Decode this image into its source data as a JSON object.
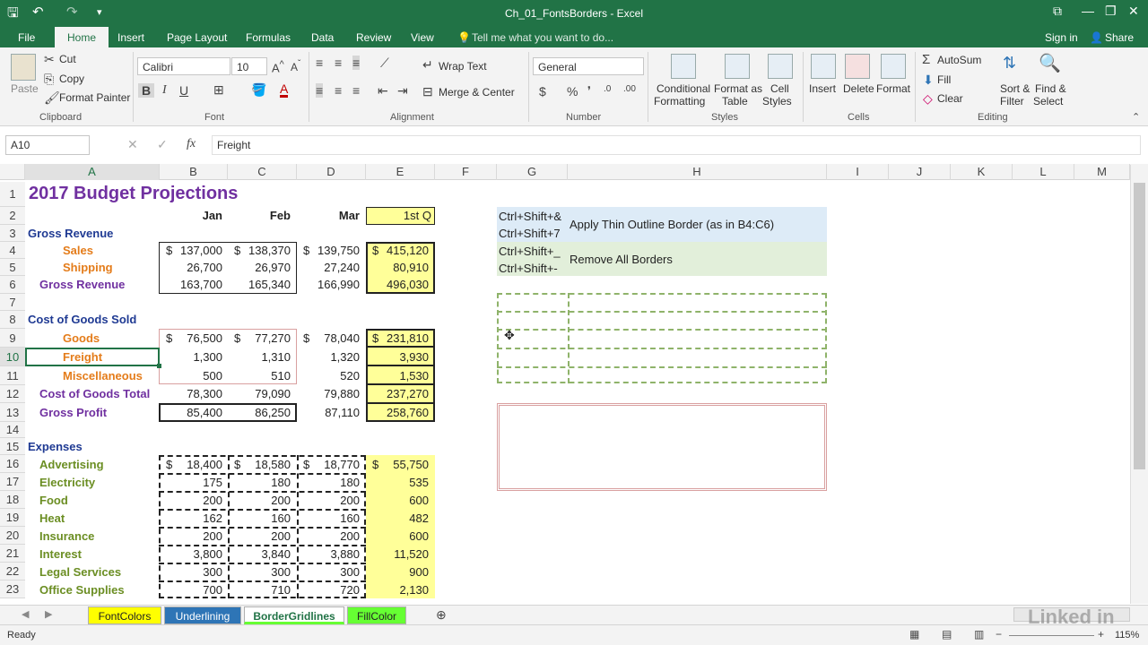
{
  "window": {
    "title": "Ch_01_FontsBorders - Excel"
  },
  "tabs": [
    "File",
    "Home",
    "Insert",
    "Page Layout",
    "Formulas",
    "Data",
    "Review",
    "View"
  ],
  "tell_me": "Tell me what you want to do...",
  "account": {
    "sign_in": "Sign in",
    "share": "Share"
  },
  "ribbon": {
    "clipboard": {
      "paste": "Paste",
      "cut": "Cut",
      "copy": "Copy",
      "format_painter": "Format Painter",
      "label": "Clipboard"
    },
    "font": {
      "name": "Calibri",
      "size": "10",
      "label": "Font"
    },
    "alignment": {
      "wrap": "Wrap Text",
      "merge": "Merge & Center",
      "label": "Alignment"
    },
    "number": {
      "format": "General",
      "label": "Number"
    },
    "styles": {
      "cond1": "Conditional",
      "cond2": "Formatting",
      "fmt1": "Format as",
      "fmt2": "Table",
      "cell1": "Cell",
      "cell2": "Styles",
      "label": "Styles"
    },
    "cells": {
      "insert": "Insert",
      "delete": "Delete",
      "format": "Format",
      "label": "Cells"
    },
    "editing": {
      "autosum": "AutoSum",
      "fill": "Fill",
      "clear": "Clear",
      "sort1": "Sort &",
      "sort2": "Filter",
      "find1": "Find &",
      "find2": "Select",
      "label": "Editing"
    }
  },
  "formula_bar": {
    "name_box": "A10",
    "value": "Freight"
  },
  "columns": [
    "A",
    "B",
    "C",
    "D",
    "E",
    "F",
    "G",
    "H",
    "I",
    "J",
    "K",
    "L",
    "M"
  ],
  "rows": [
    "1",
    "2",
    "3",
    "4",
    "5",
    "6",
    "7",
    "8",
    "9",
    "10",
    "11",
    "12",
    "13",
    "14",
    "15",
    "16",
    "17",
    "18",
    "19",
    "20",
    "21",
    "22",
    "23"
  ],
  "sheet": {
    "title": "2017 Budget Projections",
    "h_jan": "Jan",
    "h_feb": "Feb",
    "h_mar": "Mar",
    "h_q": "1st Q",
    "gross_revenue": "Gross Revenue",
    "sales": "Sales",
    "shipping": "Shipping",
    "gross_revenue_total": "Gross Revenue",
    "cogs": "Cost of Goods Sold",
    "goods": "Goods",
    "freight": "Freight",
    "misc": "Miscellaneous",
    "cogs_total": "Cost of Goods Total",
    "gross_profit": "Gross Profit",
    "expenses": "Expenses",
    "sales_vals": [
      "137,000",
      "138,370",
      "139,750",
      "415,120"
    ],
    "shipping_vals": [
      "26,700",
      "26,970",
      "27,240",
      "80,910"
    ],
    "grt_vals": [
      "163,700",
      "165,340",
      "166,990",
      "496,030"
    ],
    "goods_vals": [
      "76,500",
      "77,270",
      "78,040",
      "231,810"
    ],
    "freight_vals": [
      "1,300",
      "1,310",
      "1,320",
      "3,930"
    ],
    "misc_vals": [
      "500",
      "510",
      "520",
      "1,530"
    ],
    "cogst_vals": [
      "78,300",
      "79,090",
      "79,880",
      "237,270"
    ],
    "gp_vals": [
      "85,400",
      "86,250",
      "87,110",
      "258,760"
    ],
    "expense_rows": [
      {
        "label": "Advertising",
        "v": [
          "18,400",
          "18,580",
          "18,770",
          "55,750"
        ]
      },
      {
        "label": "Electricity",
        "v": [
          "175",
          "180",
          "180",
          "535"
        ]
      },
      {
        "label": "Food",
        "v": [
          "200",
          "200",
          "200",
          "600"
        ]
      },
      {
        "label": "Heat",
        "v": [
          "162",
          "160",
          "160",
          "482"
        ]
      },
      {
        "label": "Insurance",
        "v": [
          "200",
          "200",
          "200",
          "600"
        ]
      },
      {
        "label": "Interest",
        "v": [
          "3,800",
          "3,840",
          "3,880",
          "11,520"
        ]
      },
      {
        "label": "Legal Services",
        "v": [
          "300",
          "300",
          "300",
          "900"
        ]
      },
      {
        "label": "Office Supplies",
        "v": [
          "700",
          "710",
          "720",
          "2,130"
        ]
      }
    ],
    "dollar": "$",
    "shortcut1a": "Ctrl+Shift+&",
    "shortcut1b": "Ctrl+Shift+7",
    "desc1": "Apply Thin Outline Border  (as in B4:C6)",
    "shortcut2a": "Ctrl+Shift+_",
    "shortcut2b": "Ctrl+Shift+-",
    "desc2": "Remove All Borders"
  },
  "sheet_tabs": [
    "FontColors",
    "Underlining",
    "BorderGridlines",
    "FillColor"
  ],
  "status": {
    "ready": "Ready",
    "zoom": "115%"
  },
  "watermark": "Linked in",
  "colors": {
    "excel_green": "#217346",
    "yellow": "#ffff99",
    "blue_tab": "#2e75b6",
    "green_tab": "#66ff33"
  }
}
